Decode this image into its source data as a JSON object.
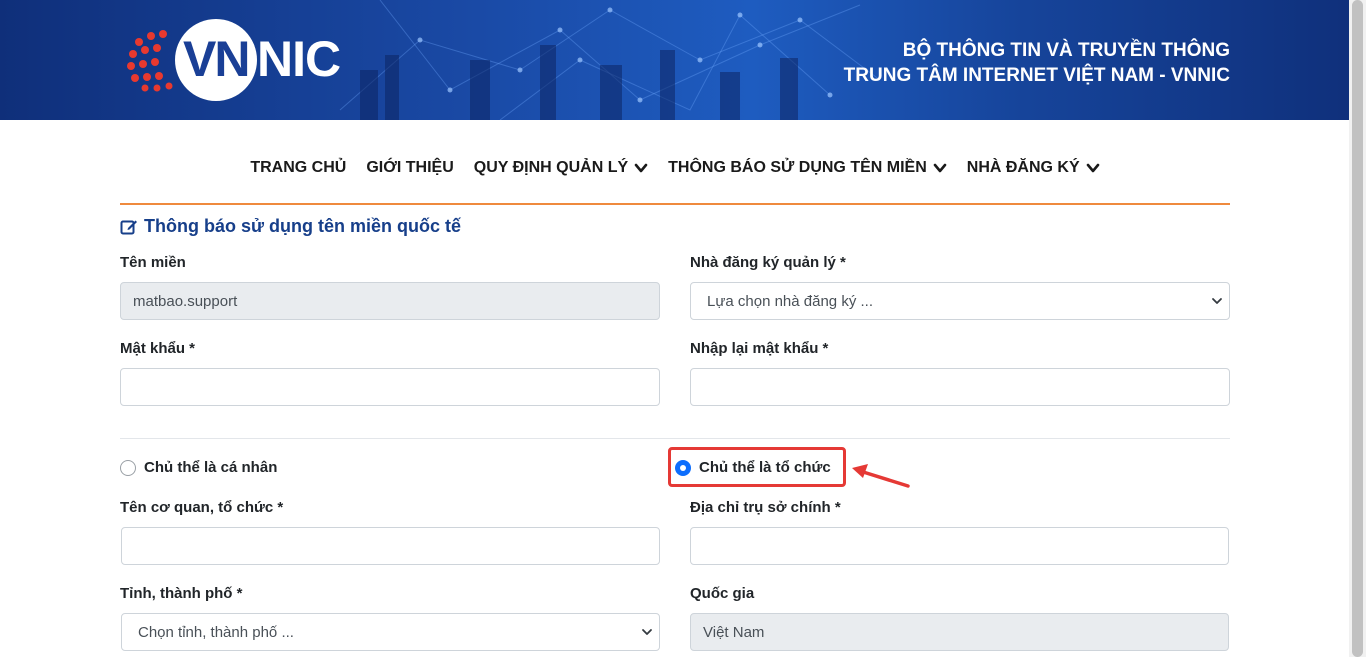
{
  "header": {
    "logo_text_vn": "VN",
    "logo_text_nic": "NIC",
    "org_line1": "BỘ THÔNG TIN VÀ TRUYỀN THÔNG",
    "org_line2": "TRUNG TÂM INTERNET VIỆT NAM - VNNIC"
  },
  "nav": {
    "items": [
      {
        "label": "TRANG CHỦ",
        "dropdown": false
      },
      {
        "label": "GIỚI THIỆU",
        "dropdown": false
      },
      {
        "label": "QUY ĐỊNH QUẢN LÝ",
        "dropdown": true
      },
      {
        "label": "THÔNG BÁO SỬ DỤNG TÊN MIỀN",
        "dropdown": true
      },
      {
        "label": "NHÀ ĐĂNG KÝ",
        "dropdown": true
      }
    ]
  },
  "form": {
    "title": "Thông báo sử dụng tên miền quốc tế",
    "domain_label": "Tên miền",
    "domain_value": "matbao.support",
    "registrar_label": "Nhà đăng ký quản lý *",
    "registrar_value": "Lựa chọn nhà đăng ký ...",
    "password_label": "Mật khẩu *",
    "password_value": "",
    "password_confirm_label": "Nhập lại mật khẩu *",
    "password_confirm_value": "",
    "subject_individual_label": "Chủ thể là cá nhân",
    "subject_org_label": "Chủ thể là tổ chức",
    "subject_selected": "organization",
    "org_name_label": "Tên cơ quan, tổ chức *",
    "org_name_value": "",
    "address_label": "Địa chỉ trụ sở chính *",
    "address_value": "",
    "province_label": "Tỉnh, thành phố *",
    "province_value": "Chọn tỉnh, thành phố ...",
    "country_label": "Quốc gia",
    "country_value": "Việt Nam"
  },
  "colors": {
    "banner": "#1a4aa6",
    "nav_rule": "#ef8a3d",
    "title": "#173f8a",
    "radio_checked": "#0d6efd",
    "annotation": "#e53935"
  }
}
